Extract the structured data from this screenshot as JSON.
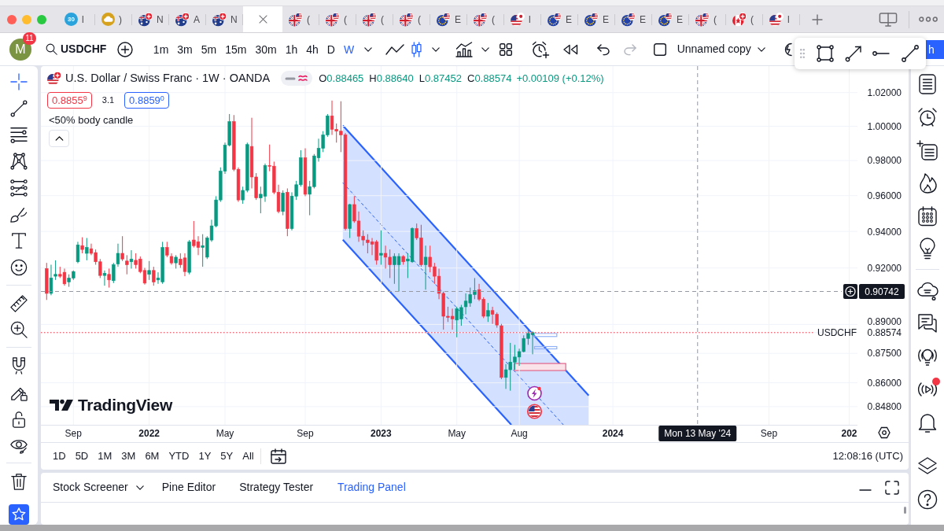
{
  "browser": {
    "tabs": [
      {
        "kind": "badge",
        "badge": "30",
        "label": "l",
        "selected": false
      },
      {
        "kind": "cloud",
        "label": ")",
        "selected": false
      },
      {
        "kind": "audflag",
        "label": "N",
        "selected": false
      },
      {
        "kind": "audflag",
        "label": "A",
        "selected": false
      },
      {
        "kind": "audflag",
        "label": "N",
        "selected": false
      },
      {
        "kind": "blank",
        "selected": true
      },
      {
        "kind": "gbpflag",
        "label": "(",
        "selected": false
      },
      {
        "kind": "gbpflag",
        "label": "(",
        "selected": false
      },
      {
        "kind": "gbpflag",
        "label": "(",
        "selected": false
      },
      {
        "kind": "gbpflag",
        "label": "(",
        "selected": false
      },
      {
        "kind": "eurflag",
        "label": "E",
        "selected": false
      },
      {
        "kind": "gbpflag",
        "label": "(",
        "selected": false
      },
      {
        "kind": "usdflag",
        "label": "l",
        "selected": false
      },
      {
        "kind": "eurflag",
        "label": "E",
        "selected": false
      },
      {
        "kind": "eurflag",
        "label": "E",
        "selected": false
      },
      {
        "kind": "eurflag",
        "label": "E",
        "selected": false
      },
      {
        "kind": "eurflag",
        "label": "E",
        "selected": false
      },
      {
        "kind": "gbpflag",
        "label": "(",
        "selected": false
      },
      {
        "kind": "cadflag",
        "label": "(",
        "selected": false
      },
      {
        "kind": "usdflag",
        "label": "l",
        "selected": false
      }
    ]
  },
  "toolbar": {
    "avatar": "M",
    "notifications": "11",
    "symbol": "USDCHF",
    "intervals": [
      {
        "label": "1m",
        "selected": false
      },
      {
        "label": "3m",
        "selected": false
      },
      {
        "label": "5m",
        "selected": false
      },
      {
        "label": "15m",
        "selected": false
      },
      {
        "label": "30m",
        "selected": false
      },
      {
        "label": "1h",
        "selected": false
      },
      {
        "label": "4h",
        "selected": false
      },
      {
        "label": "D",
        "selected": false
      },
      {
        "label": "W",
        "selected": true
      }
    ],
    "undo": {
      "disabled": false
    },
    "redo": {
      "disabled": true
    },
    "layout": "Unnamed copy",
    "publish": "h"
  },
  "left_toolbar": {
    "tools": [
      {
        "selected": true
      },
      {
        "selected": false
      },
      {
        "selected": false
      },
      {
        "selected": false
      },
      {
        "selected": false
      },
      {
        "selected": false
      },
      {
        "selected": false
      },
      {
        "selected": false
      },
      {
        "selected": false
      },
      {
        "selected": false
      },
      {
        "selected": false
      },
      {
        "selected": false
      },
      {
        "selected": false
      },
      {
        "selected": false
      },
      {
        "selected": false
      }
    ],
    "favorites": {
      "on": true
    }
  },
  "legend": {
    "title": "U.S. Dollar / Swiss Franc · 1W · OANDA",
    "ohlc": [
      {
        "key": "O",
        "value": "0.88465"
      },
      {
        "key": "H",
        "value": "0.88640"
      },
      {
        "key": "L",
        "value": "0.87452"
      },
      {
        "key": "C",
        "value": "0.88574"
      }
    ],
    "change": "+0.00109 (+0.12%)",
    "sell": "0.8855$^{9}$",
    "spread": "3.1",
    "buy": "0.8859$^{0}$",
    "indicator": "<50% body candle"
  },
  "chart": {
    "logo": "TradingView",
    "chart_data": [
      {
        "type": "candlestick",
        "log": true,
        "grid": true,
        "series": [
          {
            "type": "candlestick",
            "x": [
              "2021-07-26",
              "2021-08-02",
              "2021-08-09",
              "2021-08-16",
              "2021-08-23",
              "2021-08-30",
              "2021-09-06",
              "2021-09-13",
              "2021-09-20",
              "2021-09-27",
              "2021-10-04",
              "2021-10-11",
              "2021-10-18",
              "2021-10-25",
              "2021-11-01",
              "2021-11-08",
              "2021-11-15",
              "2021-11-22",
              "2021-11-29",
              "2021-12-06",
              "2021-12-13",
              "2021-12-20",
              "2021-12-27",
              "2022-01-03",
              "2022-01-10",
              "2022-01-17",
              "2022-01-24",
              "2022-01-31",
              "2022-02-07",
              "2022-02-14",
              "2022-02-21",
              "2022-02-28",
              "2022-03-07",
              "2022-03-14",
              "2022-03-21",
              "2022-03-28",
              "2022-04-04",
              "2022-04-11",
              "2022-04-18",
              "2022-04-25",
              "2022-05-02",
              "2022-05-09",
              "2022-05-16",
              "2022-05-23",
              "2022-05-30",
              "2022-06-06",
              "2022-06-13",
              "2022-06-20",
              "2022-06-27",
              "2022-07-04",
              "2022-07-11",
              "2022-07-18",
              "2022-07-25",
              "2022-08-01",
              "2022-08-08",
              "2022-08-15",
              "2022-08-22",
              "2022-08-29",
              "2022-09-05",
              "2022-09-12",
              "2022-09-19",
              "2022-09-26",
              "2022-10-03",
              "2022-10-10",
              "2022-10-17",
              "2022-10-24",
              "2022-10-31",
              "2022-11-07",
              "2022-11-14",
              "2022-11-21",
              "2022-11-28",
              "2022-12-05",
              "2022-12-12",
              "2022-12-19",
              "2022-12-26",
              "2023-01-02",
              "2023-01-09",
              "2023-01-16",
              "2023-01-23",
              "2023-01-30",
              "2023-02-06",
              "2023-02-13",
              "2023-02-20",
              "2023-02-27",
              "2023-03-06",
              "2023-03-13",
              "2023-03-20",
              "2023-03-27",
              "2023-04-03",
              "2023-04-10",
              "2023-04-17",
              "2023-04-24",
              "2023-05-01",
              "2023-05-08",
              "2023-05-15",
              "2023-05-22",
              "2023-05-29",
              "2023-06-05",
              "2023-06-12",
              "2023-06-19",
              "2023-06-26",
              "2023-07-03",
              "2023-07-10",
              "2023-07-17",
              "2023-07-24",
              "2023-07-31",
              "2023-08-07",
              "2023-08-14",
              "2023-08-21",
              "2023-08-28"
            ],
            "ohlc": [
              [
                0.9197,
                0.9228,
                0.9029,
                0.9064
              ],
              [
                0.9064,
                0.9218,
                0.9054,
                0.9146
              ],
              [
                0.9156,
                0.9242,
                0.9136,
                0.9166
              ],
              [
                0.9166,
                0.9207,
                0.9146,
                0.9156
              ],
              [
                0.9177,
                0.9197,
                0.9105,
                0.9115
              ],
              [
                0.9125,
                0.9166,
                0.9099,
                0.9146
              ],
              [
                0.9146,
                0.9187,
                0.9136,
                0.9181
              ],
              [
                0.9234,
                0.9343,
                0.9226,
                0.9326
              ],
              [
                0.9322,
                0.9368,
                0.928,
                0.9301
              ],
              [
                0.928,
                0.9364,
                0.9242,
                0.9312
              ],
              [
                0.9305,
                0.9333,
                0.927,
                0.928
              ],
              [
                0.9284,
                0.9301,
                0.9218,
                0.9234
              ],
              [
                0.9234,
                0.9249,
                0.9146,
                0.916
              ],
              [
                0.916,
                0.9187,
                0.9105,
                0.9172
              ],
              [
                0.9166,
                0.9197,
                0.9095,
                0.9136
              ],
              [
                0.9132,
                0.9228,
                0.9119,
                0.9218
              ],
              [
                0.9222,
                0.9333,
                0.9207,
                0.928
              ],
              [
                0.928,
                0.9374,
                0.9238,
                0.9249
              ],
              [
                0.9238,
                0.927,
                0.9166,
                0.9218
              ],
              [
                0.9234,
                0.9297,
                0.9197,
                0.9249
              ],
              [
                0.9242,
                0.928,
                0.9197,
                0.9218
              ],
              [
                0.9249,
                0.9263,
                0.9172,
                0.9181
              ],
              [
                0.9187,
                0.9201,
                0.9111,
                0.9119
              ],
              [
                0.9166,
                0.9238,
                0.9136,
                0.9187
              ],
              [
                0.9187,
                0.9207,
                0.9105,
                0.9125
              ],
              [
                0.9136,
                0.9177,
                0.9115,
                0.9146
              ],
              [
                0.9125,
                0.9343,
                0.9115,
                0.9312
              ],
              [
                0.9312,
                0.9343,
                0.9259,
                0.927
              ],
              [
                0.9263,
                0.928,
                0.9218,
                0.9228
              ],
              [
                0.9228,
                0.927,
                0.9197,
                0.9259
              ],
              [
                0.9249,
                0.928,
                0.9201,
                0.9218
              ],
              [
                0.9255,
                0.928,
                0.9156,
                0.9181
              ],
              [
                0.9177,
                0.9353,
                0.9166,
                0.9343
              ],
              [
                0.9353,
                0.9458,
                0.9312,
                0.9322
              ],
              [
                0.9343,
                0.9374,
                0.927,
                0.9312
              ],
              [
                0.9312,
                0.9385,
                0.9207,
                0.9322
              ],
              [
                0.9259,
                0.9374,
                0.9249,
                0.9364
              ],
              [
                0.9353,
                0.9465,
                0.9343,
                0.9431
              ],
              [
                0.9431,
                0.9597,
                0.9423,
                0.9576
              ],
              [
                0.9576,
                0.9761,
                0.9565,
                0.9739
              ],
              [
                0.9739,
                0.9904,
                0.9724,
                0.9889
              ],
              [
                0.9889,
                1.0072,
                0.9882,
                1.0027
              ],
              [
                1.0027,
                1.0066,
                0.9739,
                0.975
              ],
              [
                0.975,
                0.9761,
                0.9565,
                0.9576
              ],
              [
                0.9576,
                0.9651,
                0.9554,
                0.963
              ],
              [
                0.963,
                0.9904,
                0.9619,
                0.9893
              ],
              [
                0.9882,
                1.005,
                0.9641,
                0.9706
              ],
              [
                0.9706,
                0.9728,
                0.9576,
                0.9587
              ],
              [
                0.9587,
                0.9651,
                0.9501,
                0.9608
              ],
              [
                0.9597,
                0.9783,
                0.9565,
                0.9772
              ],
              [
                0.9772,
                0.9893,
                0.9739,
                0.9768
              ],
              [
                0.9768,
                0.9794,
                0.9608,
                0.9619
              ],
              [
                0.9619,
                0.9662,
                0.9501,
                0.9511
              ],
              [
                0.9511,
                0.963,
                0.949,
                0.9615
              ],
              [
                0.9619,
                0.9641,
                0.9374,
                0.9416
              ],
              [
                0.9416,
                0.9619,
                0.9406,
                0.9597
              ],
              [
                0.9597,
                0.9684,
                0.9576,
                0.9662
              ],
              [
                0.9662,
                0.986,
                0.9651,
                0.9816
              ],
              [
                0.9816,
                0.9871,
                0.9597,
                0.9608
              ],
              [
                0.9608,
                0.9684,
                0.949,
                0.9651
              ],
              [
                0.9651,
                0.9838,
                0.9641,
                0.9827
              ],
              [
                0.9816,
                0.9927,
                0.9794,
                0.9871
              ],
              [
                0.9871,
                0.9971,
                0.9849,
                0.9949
              ],
              [
                0.9949,
                1.0072,
                0.9938,
                1.0061
              ],
              [
                1.0061,
                1.0152,
                0.9949,
                0.9982
              ],
              [
                0.9982,
                1.0016,
                0.9904,
                0.9971
              ],
              [
                0.9971,
                1.0148,
                0.9849,
                0.9949
              ],
              [
                0.9949,
                0.996,
                0.9406,
                0.9416
              ],
              [
                0.9416,
                0.9554,
                0.9364,
                0.955
              ],
              [
                0.955,
                0.9597,
                0.9448,
                0.9458
              ],
              [
                0.9458,
                0.9511,
                0.9343,
                0.9374
              ],
              [
                0.9374,
                0.9406,
                0.9322,
                0.9353
              ],
              [
                0.9353,
                0.9385,
                0.928,
                0.9339
              ],
              [
                0.9343,
                0.9364,
                0.927,
                0.933
              ],
              [
                0.9343,
                0.9353,
                0.9218,
                0.9242
              ],
              [
                0.927,
                0.9406,
                0.9218,
                0.928
              ],
              [
                0.928,
                0.9322,
                0.9197,
                0.9259
              ],
              [
                0.9259,
                0.9301,
                0.9146,
                0.9218
              ],
              [
                0.9218,
                0.928,
                0.9115,
                0.9263
              ],
              [
                0.9218,
                0.928,
                0.9074,
                0.9263
              ],
              [
                0.9263,
                0.927,
                0.9218,
                0.9234
              ],
              [
                0.9238,
                0.928,
                0.9146,
                0.9249
              ],
              [
                0.9234,
                0.9423,
                0.9228,
                0.9416
              ],
              [
                0.9416,
                0.9444,
                0.9353,
                0.9364
              ],
              [
                0.9364,
                0.9437,
                0.9207,
                0.9218
              ],
              [
                0.9218,
                0.9322,
                0.9084,
                0.9259
              ],
              [
                0.9259,
                0.9322,
                0.9177,
                0.9207
              ],
              [
                0.9207,
                0.9228,
                0.9115,
                0.9156
              ],
              [
                0.9156,
                0.9197,
                0.9033,
                0.9064
              ],
              [
                0.9064,
                0.9074,
                0.8873,
                0.8943
              ],
              [
                0.8943,
                0.8993,
                0.8913,
                0.8937
              ],
              [
                0.8943,
                0.8983,
                0.8873,
                0.8929
              ],
              [
                0.8923,
                0.8993,
                0.8833,
                0.8983
              ],
              [
                0.8929,
                0.9003,
                0.8893,
                0.8989
              ],
              [
                0.8993,
                0.9064,
                0.8953,
                0.9023
              ],
              [
                0.9013,
                0.9095,
                0.8993,
                0.9058
              ],
              [
                0.9058,
                0.9146,
                0.9033,
                0.9078
              ],
              [
                0.9084,
                0.9115,
                0.9023,
                0.9033
              ],
              [
                0.9033,
                0.9043,
                0.8933,
                0.8943
              ],
              [
                0.8943,
                0.9013,
                0.8913,
                0.8973
              ],
              [
                0.8973,
                0.8993,
                0.8903,
                0.8953
              ],
              [
                0.8953,
                0.8963,
                0.8883,
                0.8897
              ],
              [
                0.8893,
                0.8903,
                0.8618,
                0.8627
              ],
              [
                0.8627,
                0.8695,
                0.8569,
                0.8666
              ],
              [
                0.8666,
                0.8804,
                0.856,
                0.8705
              ],
              [
                0.8705,
                0.8794,
                0.8666,
                0.8731
              ],
              [
                0.8731,
                0.8774,
                0.8686,
                0.8759
              ],
              [
                0.8759,
                0.8843,
                0.8755,
                0.8827
              ],
              [
                0.8827,
                0.8873,
                0.8794,
                0.8853
              ],
              [
                0.88465,
                0.8864,
                0.87452,
                0.88574
              ]
            ]
          }
        ],
        "xlim": [
          "2021-07-17",
          "2025-01-19"
        ],
        "ylim": [
          0.839,
          1.036
        ],
        "yticks": [
          {
            "value": 1.02,
            "label": "1.02000"
          },
          {
            "value": 1.0,
            "label": "1.00000"
          },
          {
            "value": 0.98,
            "label": "0.98000"
          },
          {
            "value": 0.96,
            "label": "0.96000"
          },
          {
            "value": 0.94,
            "label": "0.94000"
          },
          {
            "value": 0.92,
            "label": "0.92000"
          },
          {
            "value": 0.89,
            "label": "0.89000"
          },
          {
            "value": 0.88574,
            "label": "0.88574"
          },
          {
            "value": 0.875,
            "label": "0.87500"
          },
          {
            "value": 0.86,
            "label": "0.86000"
          },
          {
            "value": 0.848,
            "label": "0.84800"
          }
        ],
        "xticks": [
          {
            "value": "2021-09-06",
            "label": "Sep"
          },
          {
            "value": "2022-01-03",
            "label": "2022"
          },
          {
            "value": "2022-05-02",
            "label": "May"
          },
          {
            "value": "2022-09-05",
            "label": "Sep"
          },
          {
            "value": "2023-01-02",
            "label": "2023"
          },
          {
            "value": "2023-05-01",
            "label": "May"
          },
          {
            "value": "2023-08-07",
            "label": "Aug"
          },
          {
            "value": "2024-01-01",
            "label": "2024"
          },
          {
            "value": "2024-09-02",
            "label": "Sep"
          },
          {
            "value": "2025-01-06",
            "label": "202"
          }
        ],
        "ref_lines": [
          {
            "axis": "y",
            "value": 0.90742,
            "label": "0.90742",
            "line_style": "dashed",
            "color": "#9598a1"
          },
          {
            "axis": "y",
            "value": 0.88574,
            "label": "USDCHF",
            "line_style": "dotted",
            "color": "#f23645"
          },
          {
            "axis": "x",
            "value": "2024-05-13",
            "label": "Mon 13 May '24",
            "line_style": "dashed",
            "color": "#9598a1"
          }
        ]
      }
    ]
  },
  "time_ranges": [
    "1D",
    "5D",
    "1M",
    "3M",
    "6M",
    "YTD",
    "1Y",
    "5Y",
    "All"
  ],
  "clock": "12:08:16 (UTC)",
  "bottom_panel": {
    "tabs": [
      {
        "label": "Stock Screener",
        "selected": false,
        "menu": true
      },
      {
        "label": "Pine Editor",
        "selected": false,
        "menu": false
      },
      {
        "label": "Strategy Tester",
        "selected": false,
        "menu": false
      },
      {
        "label": "Trading Panel",
        "selected": true,
        "menu": false
      }
    ]
  },
  "right_sidebar": {
    "buttons": [
      {
        "alert": false
      },
      {
        "alert": false
      },
      {
        "alert": false
      },
      {
        "alert": false
      },
      {
        "alert": false
      },
      {
        "alert": false
      },
      {
        "alert": false
      },
      {
        "alert": false
      },
      {
        "alert": false
      },
      {
        "alert": true
      },
      {
        "alert": false
      },
      {
        "alert": false
      },
      {
        "alert": false
      }
    ]
  }
}
